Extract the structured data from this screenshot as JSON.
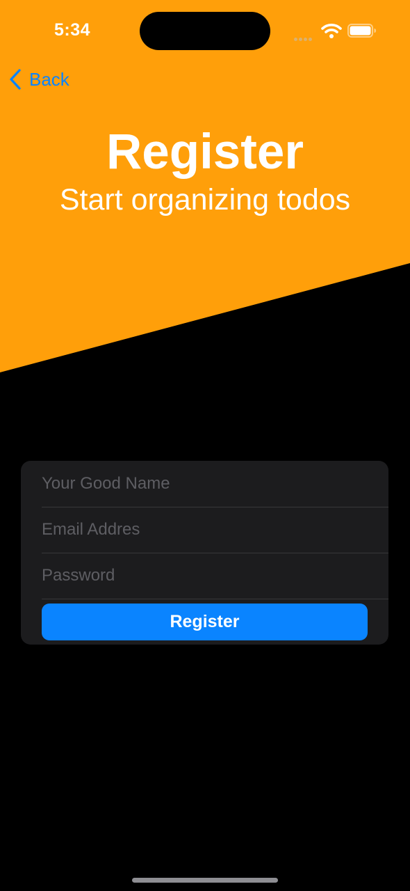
{
  "status_bar": {
    "time": "5:34",
    "icons": [
      "signal-icon",
      "wifi-icon",
      "battery-icon"
    ]
  },
  "nav": {
    "back_label": "Back",
    "back_icon": "chevron-left-icon"
  },
  "header": {
    "title": "Register",
    "subtitle": "Start organizing todos"
  },
  "form": {
    "name_placeholder": "Your Good Name",
    "email_placeholder": "Email Addres",
    "password_placeholder": "Password",
    "name_value": "",
    "email_value": "",
    "password_value": "",
    "submit_label": "Register"
  },
  "colors": {
    "header_background": "#FF9F0A",
    "page_background": "#000000",
    "form_background": "#1C1C1E",
    "accent": "#0A84FF",
    "text": "#FFFFFF",
    "placeholder": "#5E5E63"
  }
}
